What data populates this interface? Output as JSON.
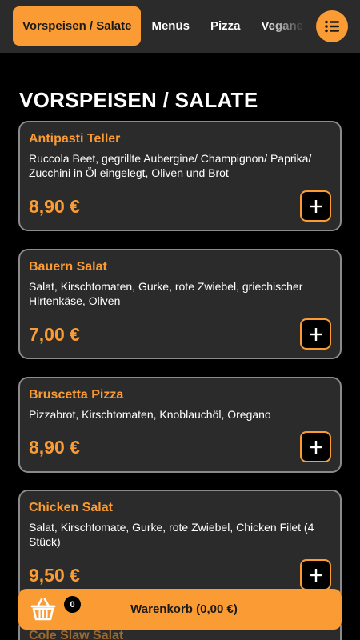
{
  "nav": {
    "tabs": [
      {
        "label": "Vorspeisen / Salate",
        "active": true
      },
      {
        "label": "Menüs",
        "active": false
      },
      {
        "label": "Pizza",
        "active": false
      },
      {
        "label": "Vegane Pizza",
        "active": false
      }
    ],
    "menu_icon": "list-icon"
  },
  "section": {
    "title": "VORSPEISEN / SALATE"
  },
  "items": [
    {
      "name": "Antipasti Teller",
      "description": "Ruccola Beet, gegrillte Aubergine/ Champignon/ Paprika/ Zucchini in Öl eingelegt, Oliven und Brot",
      "price": "8,90 €"
    },
    {
      "name": "Bauern Salat",
      "description": "Salat, Kirschtomaten, Gurke, rote Zwiebel, griechischer Hirtenkäse, Oliven",
      "price": "7,00 €"
    },
    {
      "name": "Bruscetta Pizza",
      "description": "Pizzabrot, Kirschtomaten, Knoblauchöl, Oregano",
      "price": "8,90 €"
    },
    {
      "name": "Chicken Salat",
      "description": "Salat, Kirschtomate, Gurke, rote Zwiebel, Chicken Filet (4 Stück)",
      "price": "9,50 €"
    },
    {
      "name": "Cole Slaw Salat",
      "description": "",
      "price": ""
    }
  ],
  "cart": {
    "label": "Warenkorb (0,00 €)",
    "count": "0",
    "icon": "basket-icon"
  },
  "colors": {
    "accent": "#fa9c33",
    "card_bg": "#2b2b2b",
    "card_border": "#8a8a8a",
    "page_bg": "#000000"
  }
}
